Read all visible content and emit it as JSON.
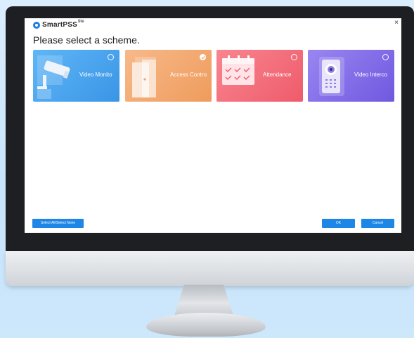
{
  "app": {
    "logo_text": "SmartPSS",
    "logo_sup": "lite",
    "close_glyph": "×"
  },
  "main": {
    "heading": "Please select a scheme.",
    "schemes": [
      {
        "label": "Video Monito",
        "icon": "camera-icon",
        "selected": false,
        "color": "#3a95e6"
      },
      {
        "label": "Access Contro",
        "icon": "door-icon",
        "selected": true,
        "color": "#ef9c5c"
      },
      {
        "label": "Attendance",
        "icon": "calendar-icon",
        "selected": false,
        "color": "#ef5b6b"
      },
      {
        "label": "Video Interco",
        "icon": "intercom-icon",
        "selected": false,
        "color": "#7058df"
      }
    ]
  },
  "footer": {
    "select_all_label": "Select All/Select None",
    "ok_label": "OK",
    "cancel_label": "Cancel",
    "button_color": "#1e86e6"
  }
}
